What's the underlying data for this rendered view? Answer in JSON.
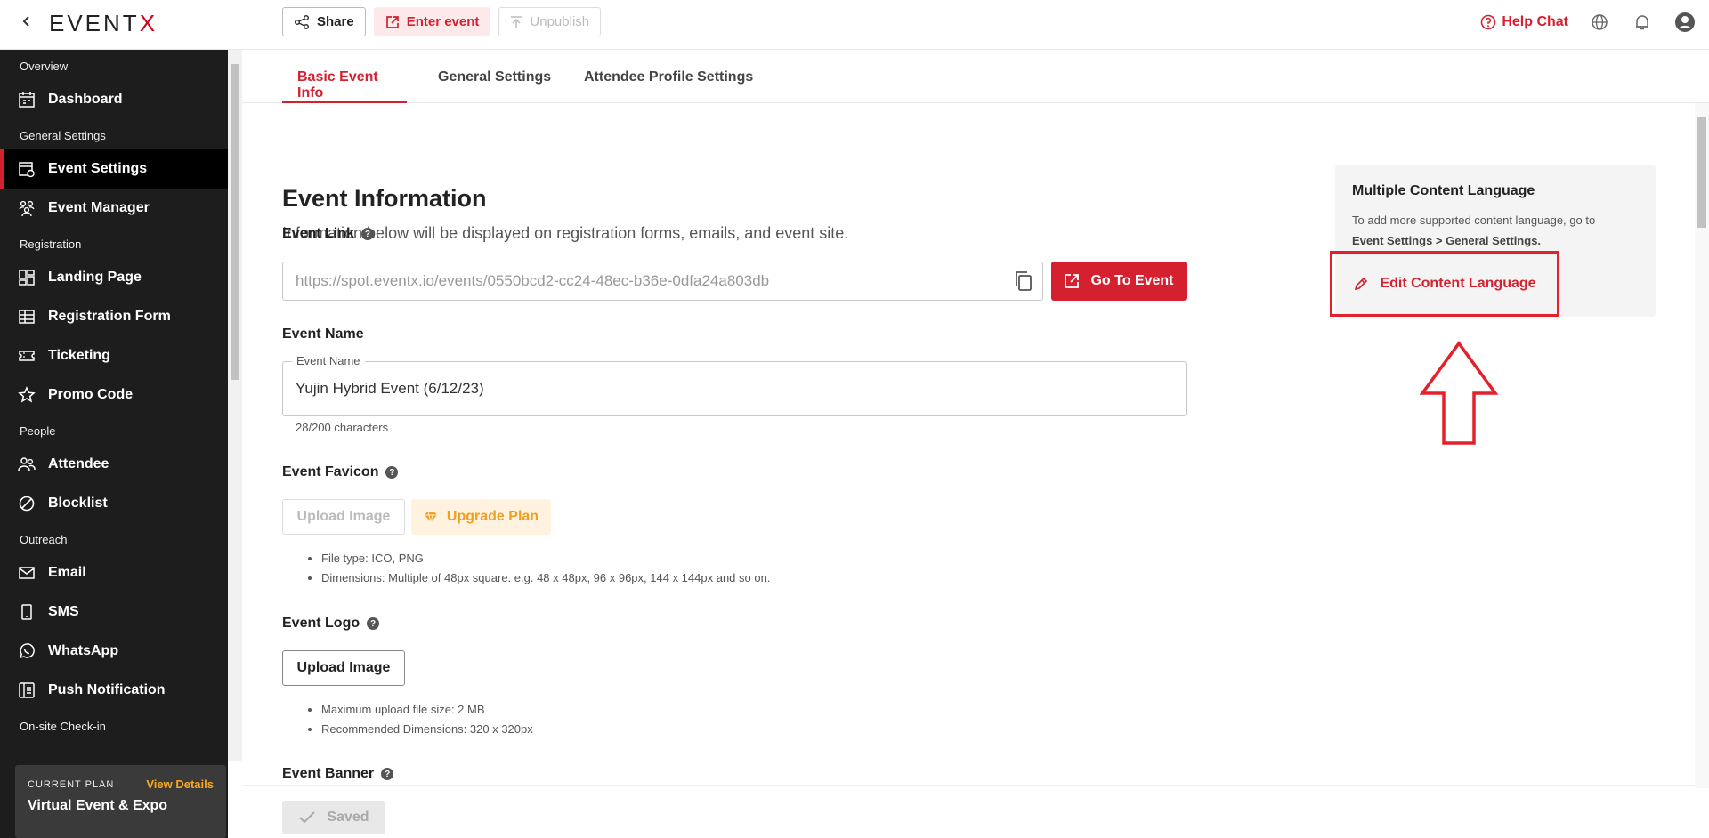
{
  "app": {
    "logo_text": "EVENT",
    "logo_accent": "X",
    "brand_color": "#d4202f"
  },
  "topbar": {
    "share_label": "Share",
    "enter_event_label": "Enter event",
    "unpublish_label": "Unpublish",
    "help_chat_label": "Help Chat"
  },
  "sidebar": {
    "sections": [
      {
        "title": "Overview",
        "items": [
          {
            "label": "Dashboard",
            "icon": "calendar-icon"
          }
        ]
      },
      {
        "title": "General Settings",
        "items": [
          {
            "label": "Event Settings",
            "icon": "event-settings-icon",
            "active": true
          },
          {
            "label": "Event Manager",
            "icon": "team-icon"
          }
        ]
      },
      {
        "title": "Registration",
        "items": [
          {
            "label": "Landing Page",
            "icon": "layout-icon"
          },
          {
            "label": "Registration Form",
            "icon": "table-icon"
          },
          {
            "label": "Ticketing",
            "icon": "ticket-icon"
          },
          {
            "label": "Promo Code",
            "icon": "star-icon"
          }
        ]
      },
      {
        "title": "People",
        "items": [
          {
            "label": "Attendee",
            "icon": "people-icon"
          },
          {
            "label": "Blocklist",
            "icon": "block-icon"
          }
        ]
      },
      {
        "title": "Outreach",
        "items": [
          {
            "label": "Email",
            "icon": "mail-icon"
          },
          {
            "label": "SMS",
            "icon": "phone-icon"
          },
          {
            "label": "WhatsApp",
            "icon": "whatsapp-icon"
          },
          {
            "label": "Push Notification",
            "icon": "push-notification-icon"
          }
        ]
      },
      {
        "title": "On-site Check-in",
        "items": []
      }
    ],
    "plan": {
      "label": "CURRENT PLAN",
      "link": "View Details",
      "name": "Virtual Event & Expo"
    }
  },
  "tabs": [
    {
      "label": "Basic Event Info",
      "active": true
    },
    {
      "label": "General Settings",
      "active": false
    },
    {
      "label": "Attendee Profile Settings",
      "active": false
    }
  ],
  "form": {
    "title": "Event Information",
    "subtitle": "Information below will be displayed on registration forms, emails, and event site.",
    "event_link": {
      "label": "Event Link",
      "value": "https://spot.eventx.io/events/0550bcd2-cc24-48ec-b36e-0dfa24a803db",
      "go_button": "Go To Event"
    },
    "event_name": {
      "label": "Event Name",
      "legend": "Event Name",
      "value": "Yujin Hybrid Event (6/12/23)",
      "char_count": "28/200 characters"
    },
    "favicon": {
      "label": "Event Favicon",
      "upload_label": "Upload Image",
      "upgrade_label": "Upgrade Plan",
      "notes": [
        "File type: ICO, PNG",
        "Dimensions: Multiple of 48px square. e.g. 48 x 48px, 96 x 96px, 144 x 144px and so on."
      ]
    },
    "logo": {
      "label": "Event Logo",
      "upload_label": "Upload Image",
      "notes": [
        "Maximum upload file size: 2 MB",
        "Recommended Dimensions: 320 x 320px"
      ]
    },
    "banner": {
      "label": "Event Banner"
    },
    "saved_label": "Saved"
  },
  "language_card": {
    "title": "Multiple Content Language",
    "desc_line1": "To add more supported content language, go to",
    "desc_line2": "Event Settings > General Settings.",
    "edit_label": "Edit Content Language"
  }
}
